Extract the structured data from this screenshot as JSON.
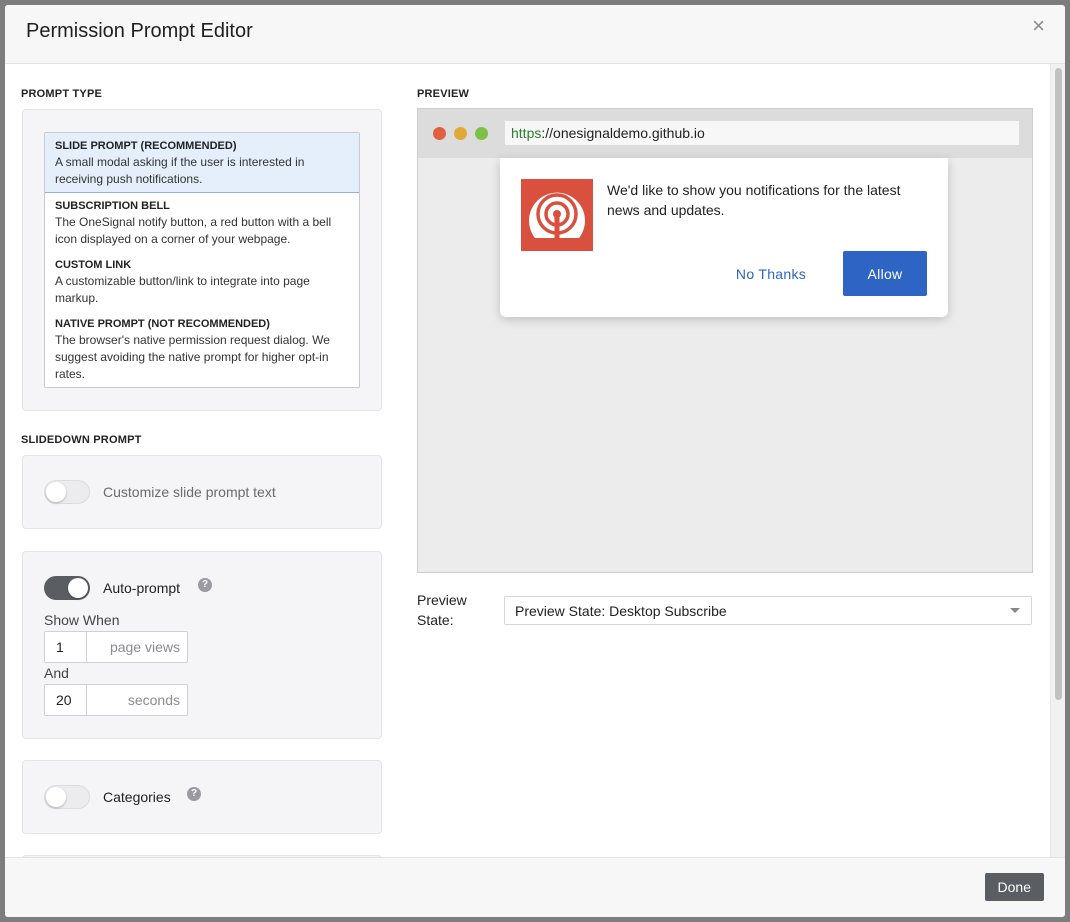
{
  "dialog": {
    "title": "Permission Prompt Editor",
    "close_glyph": "×",
    "done_label": "Done"
  },
  "prompt_type": {
    "section_label": "PROMPT TYPE",
    "options": [
      {
        "title": "SLIDE PROMPT (RECOMMENDED)",
        "desc": "A small modal asking if the user is interested in receiving push notifications.",
        "selected": true
      },
      {
        "title": "SUBSCRIPTION BELL",
        "desc": "The OneSignal notify button, a red button with a bell icon displayed on a corner of your webpage.",
        "selected": false
      },
      {
        "title": "CUSTOM LINK",
        "desc": "A customizable button/link to integrate into page markup.",
        "selected": false
      },
      {
        "title": "NATIVE PROMPT (NOT RECOMMENDED)",
        "desc": "The browser's native permission request dialog. We suggest avoiding the native prompt for higher opt-in rates.",
        "selected": false
      }
    ]
  },
  "slidedown_prompt": {
    "section_label": "SLIDEDOWN PROMPT",
    "customize_text": {
      "label": "Customize slide prompt text",
      "enabled": false
    },
    "auto_prompt": {
      "label": "Auto-prompt",
      "enabled": true,
      "help_glyph": "?",
      "show_when_label": "Show When",
      "page_views_value": "1",
      "page_views_unit": "page views",
      "and_label": "And",
      "seconds_value": "20",
      "seconds_unit": "seconds"
    },
    "categories": {
      "label": "Categories",
      "enabled": false,
      "help_glyph": "?"
    }
  },
  "preview": {
    "section_label": "PREVIEW",
    "url_scheme": "https",
    "url_rest": "://onesignaldemo.github.io",
    "traffic_lights": [
      "#e0603f",
      "#e0a93a",
      "#7cc046"
    ],
    "slidedown": {
      "icon": "onesignal-broadcast-icon",
      "icon_bg": "#d9503e",
      "message": "We'd like to show you notifications for the latest news and updates.",
      "cancel_label": "No Thanks",
      "allow_label": "Allow",
      "accent": "#2e64c4"
    },
    "state_label_line1": "Preview",
    "state_label_line2": "State:",
    "state_value": "Preview State: Desktop Subscribe"
  }
}
